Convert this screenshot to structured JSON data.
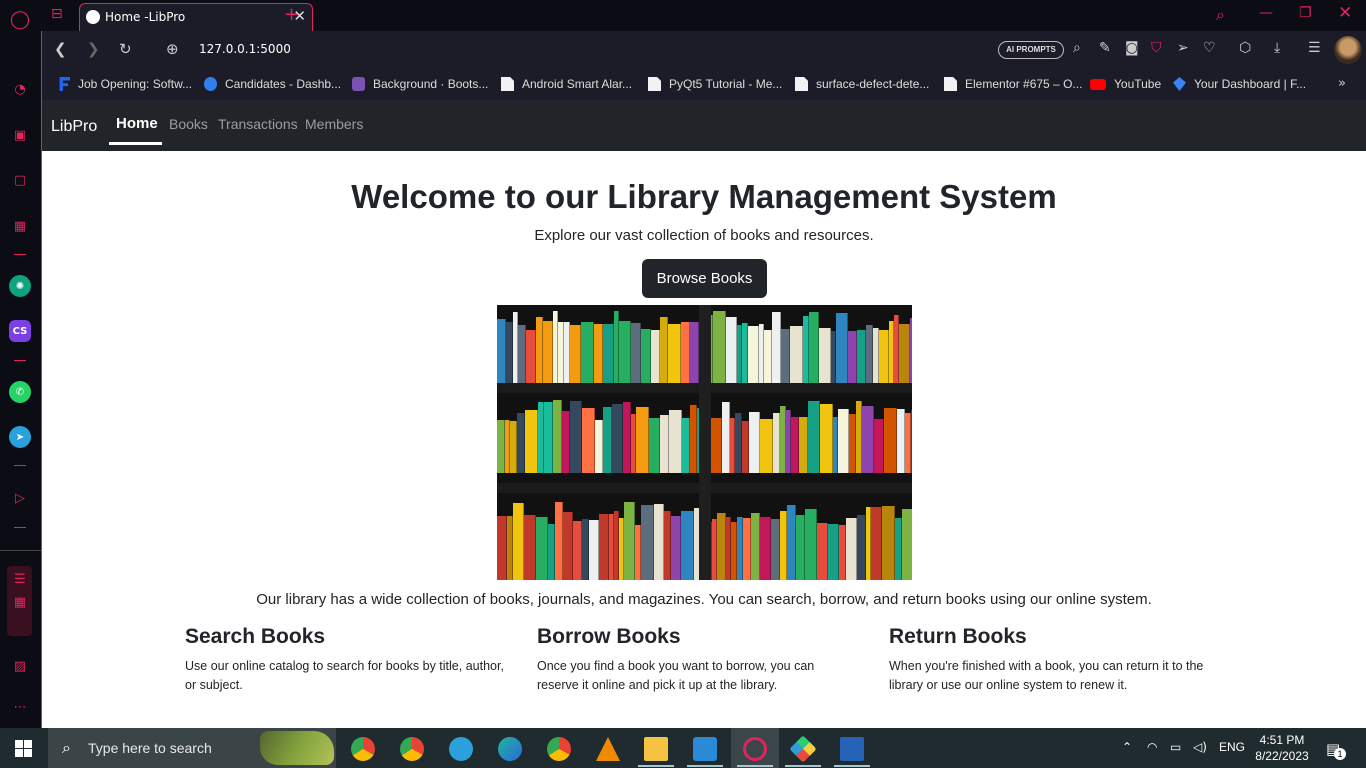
{
  "browser": {
    "tab_title": "Home -LibPro",
    "url": "127.0.0.1:5000",
    "ai_prompts_label": "AI PROMPTS",
    "bookmarks": [
      {
        "label": "Job Opening: Softw...",
        "icon": "f-logo",
        "color": "#1e66f5"
      },
      {
        "label": "Candidates - Dashb...",
        "icon": "u-logo",
        "color": "#2f80ed"
      },
      {
        "label": "Background · Boots...",
        "icon": "bootstrap-logo",
        "color": "#7952b3"
      },
      {
        "label": "Android Smart Alar...",
        "icon": "document-icon",
        "color": "#f2f2f2"
      },
      {
        "label": "PyQt5 Tutorial - Me...",
        "icon": "document-icon",
        "color": "#f2f2f2"
      },
      {
        "label": "surface-defect-dete...",
        "icon": "document-icon",
        "color": "#f2f2f2"
      },
      {
        "label": "Elementor #675 – O...",
        "icon": "document-icon",
        "color": "#f2f2f2"
      },
      {
        "label": "YouTube",
        "icon": "youtube-icon",
        "color": "#ff0000"
      },
      {
        "label": "Your Dashboard | F...",
        "icon": "diamond-logo",
        "color": "#3b82f6"
      }
    ]
  },
  "navbar": {
    "brand": "LibPro",
    "links": [
      "Home",
      "Books",
      "Transactions",
      "Members"
    ],
    "active": "Home"
  },
  "hero": {
    "title": "Welcome to our Library Management System",
    "subtitle": "Explore our vast collection of books and resources.",
    "button": "Browse Books"
  },
  "intro": "Our library has a wide collection of books, journals, and magazines. You can search, borrow, and return books using our online system.",
  "features": [
    {
      "title": "Search Books",
      "text": "Use our online catalog to search for books by title, author, or subject."
    },
    {
      "title": "Borrow Books",
      "text": "Once you find a book you want to borrow, you can reserve it online and pick it up at the library."
    },
    {
      "title": "Return Books",
      "text": "When you're finished with a book, you can return it to the library or use our online system to renew it."
    }
  ],
  "taskbar": {
    "search_placeholder": "Type here to search",
    "language": "ENG",
    "time": "4:51 PM",
    "date": "8/22/2023",
    "notification_count": "1"
  },
  "colors": {
    "accent": "#e0245e",
    "navbar_bg": "#212529",
    "button_bg": "#212529"
  }
}
